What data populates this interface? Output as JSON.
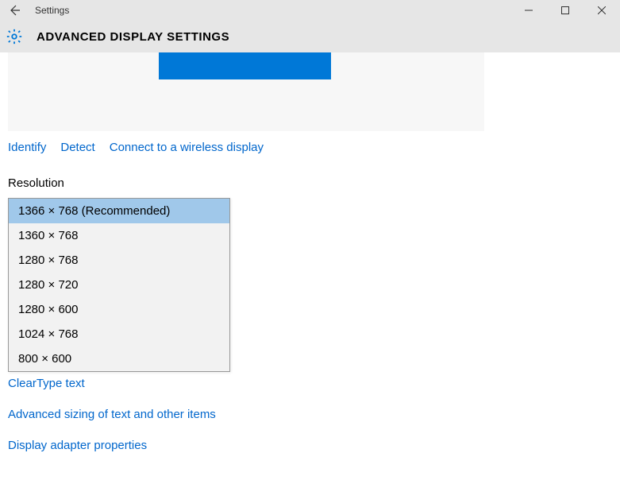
{
  "titlebar": {
    "title": "Settings"
  },
  "header": {
    "page_title": "ADVANCED DISPLAY SETTINGS"
  },
  "links": {
    "identify": "Identify",
    "detect": "Detect",
    "wireless": "Connect to a wireless display"
  },
  "resolution": {
    "label": "Resolution",
    "options": [
      "1366 × 768 (Recommended)",
      "1360 × 768",
      "1280 × 768",
      "1280 × 720",
      "1280 × 600",
      "1024 × 768",
      "800 × 600"
    ]
  },
  "under_links": {
    "cleartype": "ClearType text",
    "advanced_sizing": "Advanced sizing of text and other items",
    "adapter": "Display adapter properties"
  }
}
